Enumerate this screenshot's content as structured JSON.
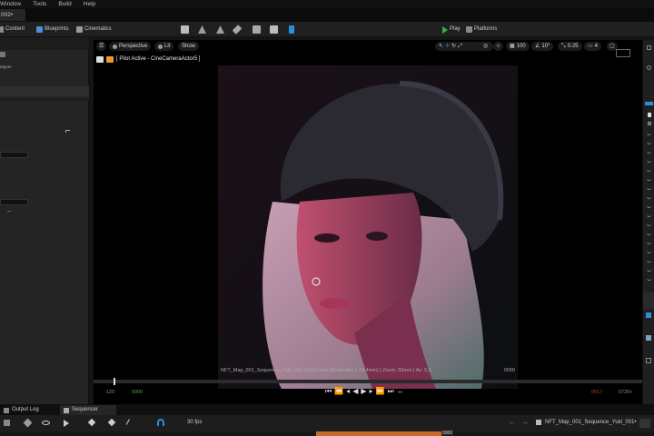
{
  "menu": [
    "Window",
    "Tools",
    "Build",
    "Help"
  ],
  "level_tab": "002•",
  "toolbar": {
    "content": "Content",
    "blueprints": "Blueprints",
    "cinematics": "Cinematics",
    "play": "Play",
    "platforms": "Platforms"
  },
  "left_panel": {
    "label": "tapper",
    "reset_icon": "reset-arrow-icon"
  },
  "viewport": {
    "perspective": "Perspective",
    "lit": "Lit",
    "show": "Show",
    "grid_snap": "100",
    "angle_snap": "10°",
    "scale_snap": "0.25",
    "camera_speed": "4",
    "pilot_text": "[ Pilot Active - CineCameraActor5 ]",
    "hud_left": "NFT_Map_001_Sequence_Yuki_001  CineCame (Moderate) x 13.4mm) | Zoom: 50mm | Av: 5.6",
    "hud_right": "0000"
  },
  "transport": {
    "start_neg": "-120",
    "start": "0000",
    "end": "0617",
    "end_pos": "0720+"
  },
  "bottom_tabs": {
    "output_log": "Output Log",
    "sequencer": "Sequencer"
  },
  "sequencer": {
    "fps": "30 fps",
    "sequence_name": "NFT_Map_001_Sequence_Yuki_001•",
    "marker": "0000"
  },
  "colors": {
    "accent_blue": "#2a8fd6",
    "play_green": "#3fae3f",
    "eject_orange": "#e89b2c",
    "end_red": "#c0392b"
  }
}
